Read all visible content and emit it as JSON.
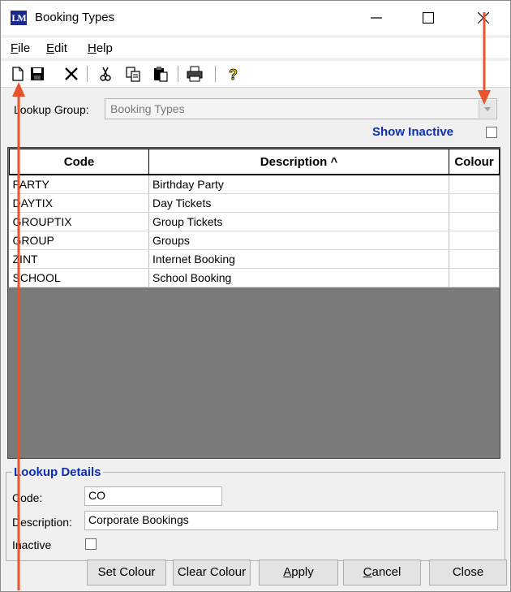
{
  "window": {
    "title": "Booking Types",
    "app_icon_text": "LM"
  },
  "menu": {
    "file": {
      "mnemonic": "F",
      "rest": "ile"
    },
    "edit": {
      "mnemonic": "E",
      "rest": "dit"
    },
    "help": {
      "mnemonic": "H",
      "rest": "elp"
    }
  },
  "toolbar": {
    "icons": [
      "new-document-icon",
      "save-icon",
      "delete-icon",
      "cut-icon",
      "copy-icon",
      "paste-icon",
      "print-icon",
      "help-icon"
    ]
  },
  "lookup": {
    "label": "Lookup Group:",
    "value": "Booking Types"
  },
  "show_inactive": {
    "label": "Show Inactive",
    "checked": false
  },
  "grid": {
    "columns": [
      "Code",
      "Description ^",
      "Colour"
    ],
    "rows": [
      {
        "code": "PARTY",
        "description": "Birthday Party",
        "colour": ""
      },
      {
        "code": "DAYTIX",
        "description": "Day Tickets",
        "colour": ""
      },
      {
        "code": "GROUPTIX",
        "description": "Group Tickets",
        "colour": ""
      },
      {
        "code": "GROUP",
        "description": "Groups",
        "colour": ""
      },
      {
        "code": "ZINT",
        "description": "Internet Booking",
        "colour": ""
      },
      {
        "code": "SCHOOL",
        "description": "School Booking",
        "colour": ""
      }
    ]
  },
  "details": {
    "title": "Lookup Details",
    "code_label": "Code:",
    "code_value": "CO",
    "description_label": "Description:",
    "description_value": "Corporate Bookings",
    "inactive_label": "Inactive",
    "inactive_checked": false
  },
  "buttons": {
    "set_colour": "Set Colour",
    "clear_colour": "Clear Colour",
    "apply": {
      "mnemonic": "A",
      "rest": "pply"
    },
    "cancel": {
      "mnemonic": "C",
      "rest": "ancel"
    },
    "close": "Close"
  },
  "colors": {
    "accent_blue": "#0a2fb3",
    "grid_background": "#7a7a7a",
    "annotation_red": "#e8532c"
  }
}
